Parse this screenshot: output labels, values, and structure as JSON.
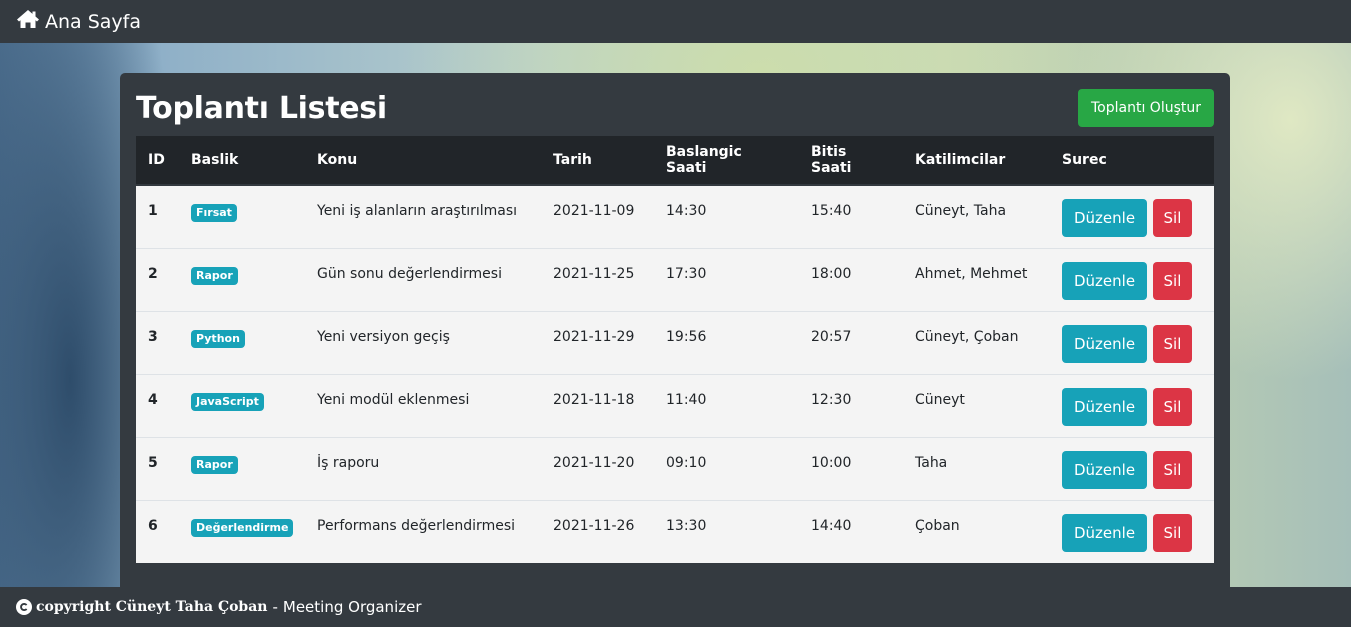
{
  "navbar": {
    "brand_icon": "home-icon",
    "brand_label": "Ana Sayfa"
  },
  "card": {
    "title_part1": "Toplantı",
    "title_part2": "Listesi",
    "create_button": "Toplantı Oluştur"
  },
  "table": {
    "headers": [
      "ID",
      "Baslik",
      "Konu",
      "Tarih",
      "Baslangic Saati",
      "Bitis Saati",
      "Katilimcilar",
      "Surec"
    ],
    "rows": [
      {
        "id": "1",
        "baslik": "Fırsat",
        "konu": "Yeni iş alanların araştırılması",
        "tarih": "2021-11-09",
        "baslangic": "14:30",
        "bitis": "15:40",
        "katilimcilar": "Cüneyt, Taha",
        "edit": "Düzenle",
        "delete": "Sil"
      },
      {
        "id": "2",
        "baslik": "Rapor",
        "konu": "Gün sonu değerlendirmesi",
        "tarih": "2021-11-25",
        "baslangic": "17:30",
        "bitis": "18:00",
        "katilimcilar": "Ahmet, Mehmet",
        "edit": "Düzenle",
        "delete": "Sil"
      },
      {
        "id": "3",
        "baslik": "Python",
        "konu": "Yeni versiyon geçiş",
        "tarih": "2021-11-29",
        "baslangic": "19:56",
        "bitis": "20:57",
        "katilimcilar": "Cüneyt, Çoban",
        "edit": "Düzenle",
        "delete": "Sil"
      },
      {
        "id": "4",
        "baslik": "JavaScript",
        "konu": "Yeni modül eklenmesi",
        "tarih": "2021-11-18",
        "baslangic": "11:40",
        "bitis": "12:30",
        "katilimcilar": "Cüneyt",
        "edit": "Düzenle",
        "delete": "Sil"
      },
      {
        "id": "5",
        "baslik": "Rapor",
        "konu": "İş raporu",
        "tarih": "2021-11-20",
        "baslangic": "09:10",
        "bitis": "10:00",
        "katilimcilar": "Taha",
        "edit": "Düzenle",
        "delete": "Sil"
      },
      {
        "id": "6",
        "baslik": "Değerlendirme",
        "konu": "Performans değerlendirmesi",
        "tarih": "2021-11-26",
        "baslangic": "13:30",
        "bitis": "14:40",
        "katilimcilar": "Çoban",
        "edit": "Düzenle",
        "delete": "Sil"
      }
    ]
  },
  "footer": {
    "icon": "copyright-icon",
    "owner": "copyright Cüneyt Taha Çoban",
    "separator": "-",
    "app_name": "Meeting Organizer"
  },
  "colors": {
    "navbar_bg": "#343a40",
    "table_header_bg": "#212529",
    "success": "#28a745",
    "info": "#17a2b8",
    "danger": "#dc3545"
  }
}
